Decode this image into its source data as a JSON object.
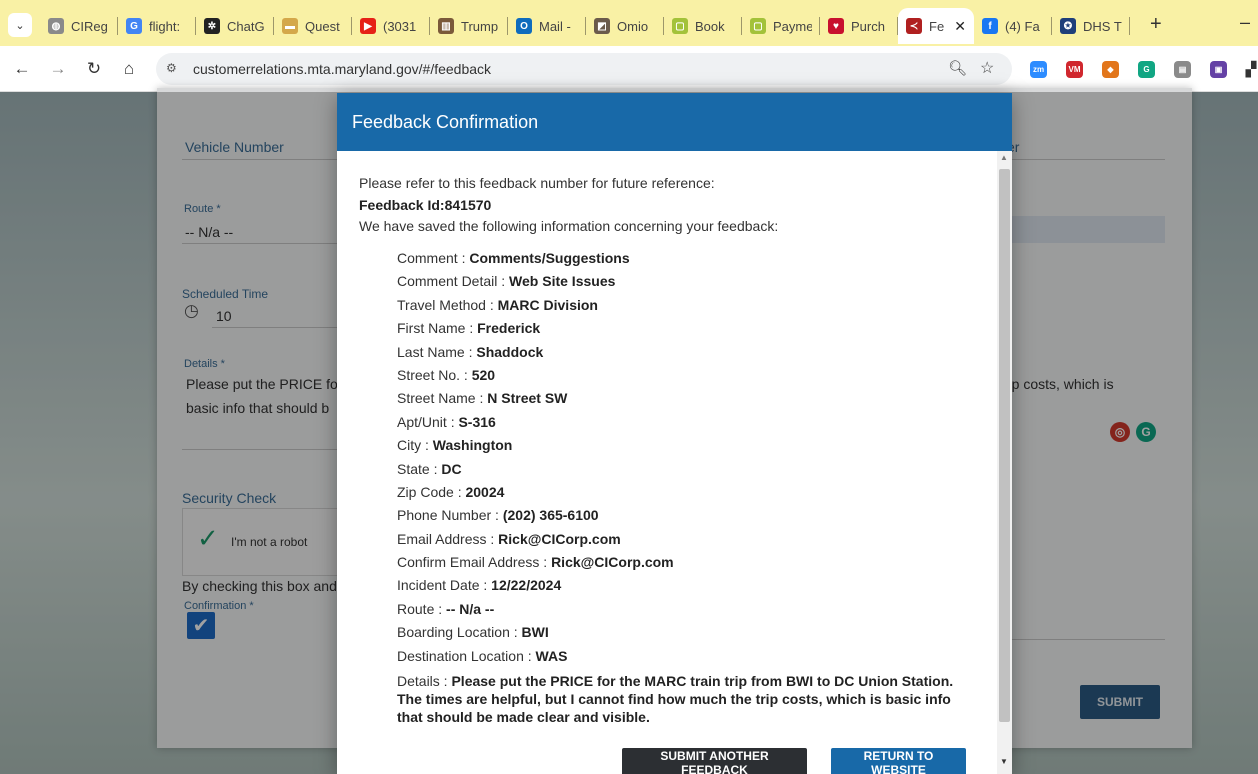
{
  "browser": {
    "tabs": [
      {
        "title": "CIReg",
        "icon": "globe-icon",
        "color": "#8a8a8a",
        "glyph": "◍"
      },
      {
        "title": "flight:",
        "icon": "google-icon",
        "color": "#4285f4",
        "glyph": "G"
      },
      {
        "title": "ChatG",
        "icon": "chatgpt-icon",
        "color": "#222222",
        "glyph": "✲"
      },
      {
        "title": "Quest",
        "icon": "quest-icon",
        "color": "#d4a84a",
        "glyph": "▬"
      },
      {
        "title": "(3031",
        "icon": "youtube-icon",
        "color": "#e62117",
        "glyph": "▶"
      },
      {
        "title": "Trump",
        "icon": "building-icon",
        "color": "#7b5a3a",
        "glyph": "▥"
      },
      {
        "title": "Mail -",
        "icon": "outlook-icon",
        "color": "#0f6cbd",
        "glyph": "O"
      },
      {
        "title": "Omio",
        "icon": "omio-icon",
        "color": "#6b5b4b",
        "glyph": "◩"
      },
      {
        "title": "Book",
        "icon": "page-icon",
        "color": "#a3c23a",
        "glyph": "▢"
      },
      {
        "title": "Payme",
        "icon": "page-icon",
        "color": "#a3c23a",
        "glyph": "▢"
      },
      {
        "title": "Purch",
        "icon": "heart-icon",
        "color": "#c8102e",
        "glyph": "♥"
      },
      {
        "title": "Fe",
        "icon": "mta-icon",
        "color": "#b02020",
        "glyph": "≺",
        "active": true
      },
      {
        "title": "(4) Fa",
        "icon": "facebook-icon",
        "color": "#1877f2",
        "glyph": "f"
      },
      {
        "title": "DHS T",
        "icon": "dhs-icon",
        "color": "#1f3f7a",
        "glyph": "✪"
      }
    ],
    "url": "customerrelations.mta.maryland.gov/#/feedback",
    "extensions": [
      {
        "name": "zoom-extension-icon",
        "color": "#2d8cff",
        "label": "zm"
      },
      {
        "name": "vm-extension-icon",
        "color": "#d0272e",
        "label": "VM"
      },
      {
        "name": "metamask-extension-icon",
        "color": "#e2761b",
        "label": "◆"
      },
      {
        "name": "grammarly-extension-icon",
        "color": "#11a683",
        "label": "G"
      },
      {
        "name": "clipboard-extension-icon",
        "color": "#8a8a8a",
        "label": "▤"
      },
      {
        "name": "twitch-extension-icon",
        "color": "#6441a5",
        "label": "▣"
      }
    ]
  },
  "form": {
    "vehicle_label": "Vehicle Number",
    "er_label": "er",
    "route_label": "Route *",
    "route_value": "-- N/a --",
    "sched_label": "Scheduled Time",
    "sched_value": "10",
    "details_label": "Details *",
    "details_line1": "Please put the PRICE fo",
    "details_line2": "basic info that should b",
    "details_right": "trip costs, which is",
    "security_label": "Security Check",
    "captcha_text": "I'm not a robot",
    "checkbox_text": "By checking this box and",
    "confirmation_label": "Confirmation *",
    "submit_label": "SUBMIT"
  },
  "modal": {
    "title": "Feedback Confirmation",
    "intro1": "Please refer to this feedback number for future reference:",
    "feedback_id": "Feedback Id:841570",
    "intro2": "We have saved the following information concerning your feedback:",
    "fields": [
      {
        "label": "Comment : ",
        "value": "Comments/Suggestions"
      },
      {
        "label": "Comment Detail : ",
        "value": "Web Site Issues"
      },
      {
        "label": "Travel Method : ",
        "value": "MARC Division"
      },
      {
        "label": "First Name : ",
        "value": "Frederick"
      },
      {
        "label": "Last Name : ",
        "value": "Shaddock"
      },
      {
        "label": "Street No. : ",
        "value": "520"
      },
      {
        "label": "Street Name : ",
        "value": "N Street SW"
      },
      {
        "label": "Apt/Unit : ",
        "value": "S-316"
      },
      {
        "label": "City : ",
        "value": "Washington"
      },
      {
        "label": "State : ",
        "value": "DC"
      },
      {
        "label": "Zip Code : ",
        "value": "20024"
      },
      {
        "label": "Phone Number : ",
        "value": "(202) 365-6100"
      },
      {
        "label": "Email Address : ",
        "value": "Rick@CICorp.com"
      },
      {
        "label": "Confirm Email Address : ",
        "value": "Rick@CICorp.com"
      },
      {
        "label": "Incident Date : ",
        "value": "12/22/2024"
      },
      {
        "label": "Route : ",
        "value": "-- N/a --"
      },
      {
        "label": "Boarding Location : ",
        "value": "BWI"
      },
      {
        "label": "Destination Location : ",
        "value": "WAS"
      },
      {
        "label": "Details : ",
        "value": "Please put the PRICE for the MARC train trip from BWI to DC Union Station. The times are helpful, but I cannot find how much the trip costs, which is basic info that should be made clear and visible."
      }
    ],
    "submit_another_label": "SUBMIT ANOTHER FEEDBACK",
    "return_label": "RETURN TO WEBSITE"
  }
}
